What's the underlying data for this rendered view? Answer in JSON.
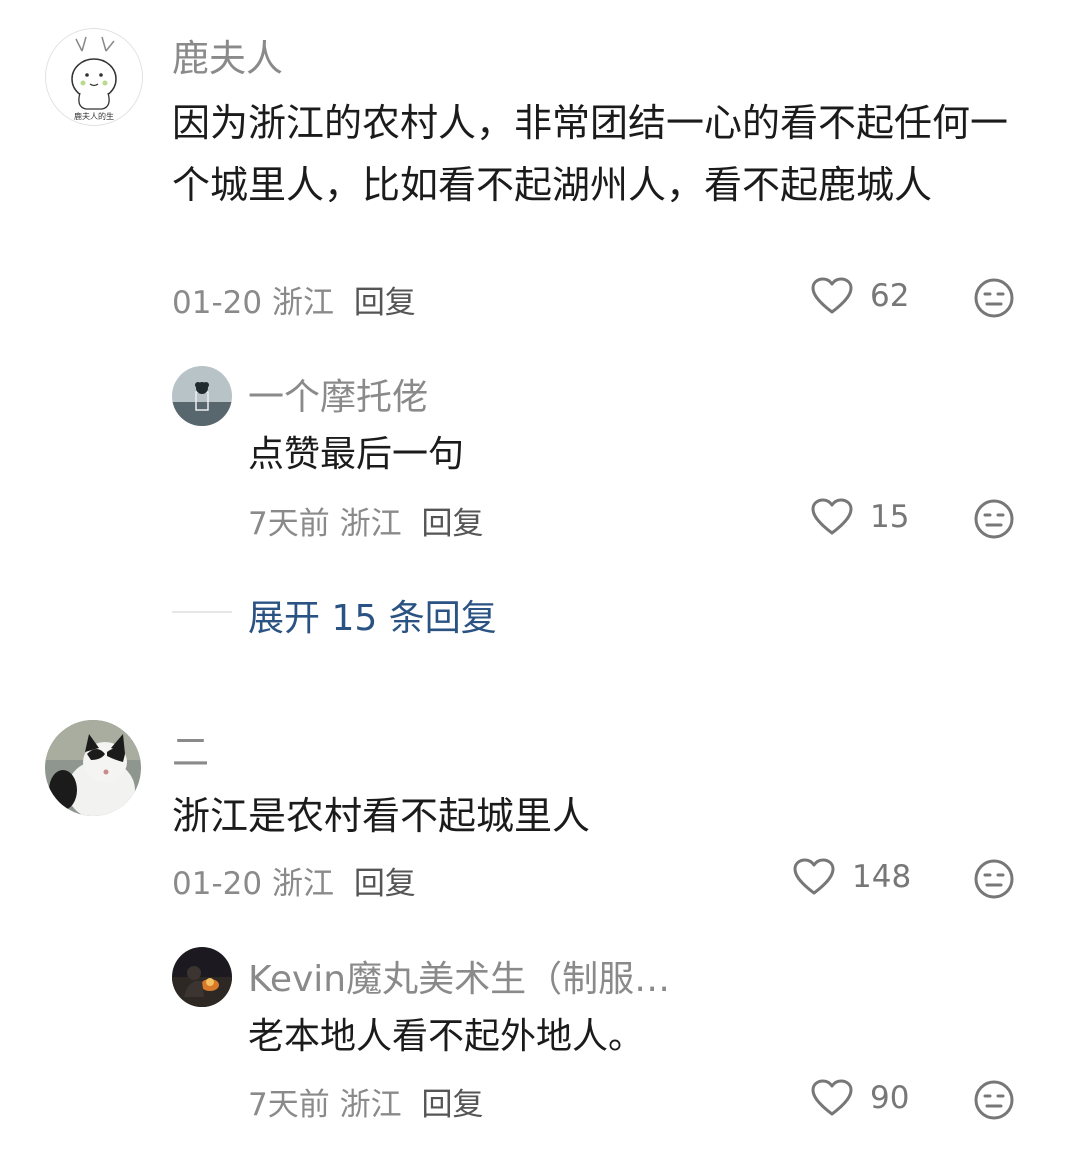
{
  "comments": [
    {
      "name": "鹿夫人",
      "avatar_caption": "鹿夫人的生",
      "text": "因为浙江的农村人，非常团结一心的看不起任何一个城里人，比如看不起湖州人，看不起鹿城人",
      "date": "01-20",
      "location": "浙江",
      "reply_label": "回复",
      "likes": "62",
      "icons": {
        "like": "heart-outline-icon",
        "dislike": "meh-face-icon"
      },
      "replies": [
        {
          "name": "一个摩托佬",
          "text": "点赞最后一句",
          "date": "7天前",
          "location": "浙江",
          "reply_label": "回复",
          "likes": "15"
        }
      ],
      "expand_label": "展开 15 条回复"
    },
    {
      "name": "二",
      "text": "浙江是农村看不起城里人",
      "date": "01-20",
      "location": "浙江",
      "reply_label": "回复",
      "likes": "148",
      "replies": [
        {
          "name": "Kevin魔丸美术生（制服…",
          "text": "老本地人看不起外地人。",
          "date": "7天前",
          "location": "浙江",
          "reply_label": "回复",
          "likes": "90"
        }
      ]
    }
  ],
  "colors": {
    "link": "#2a5384",
    "muted": "#8a8a8a",
    "text": "#1b1b1b"
  }
}
